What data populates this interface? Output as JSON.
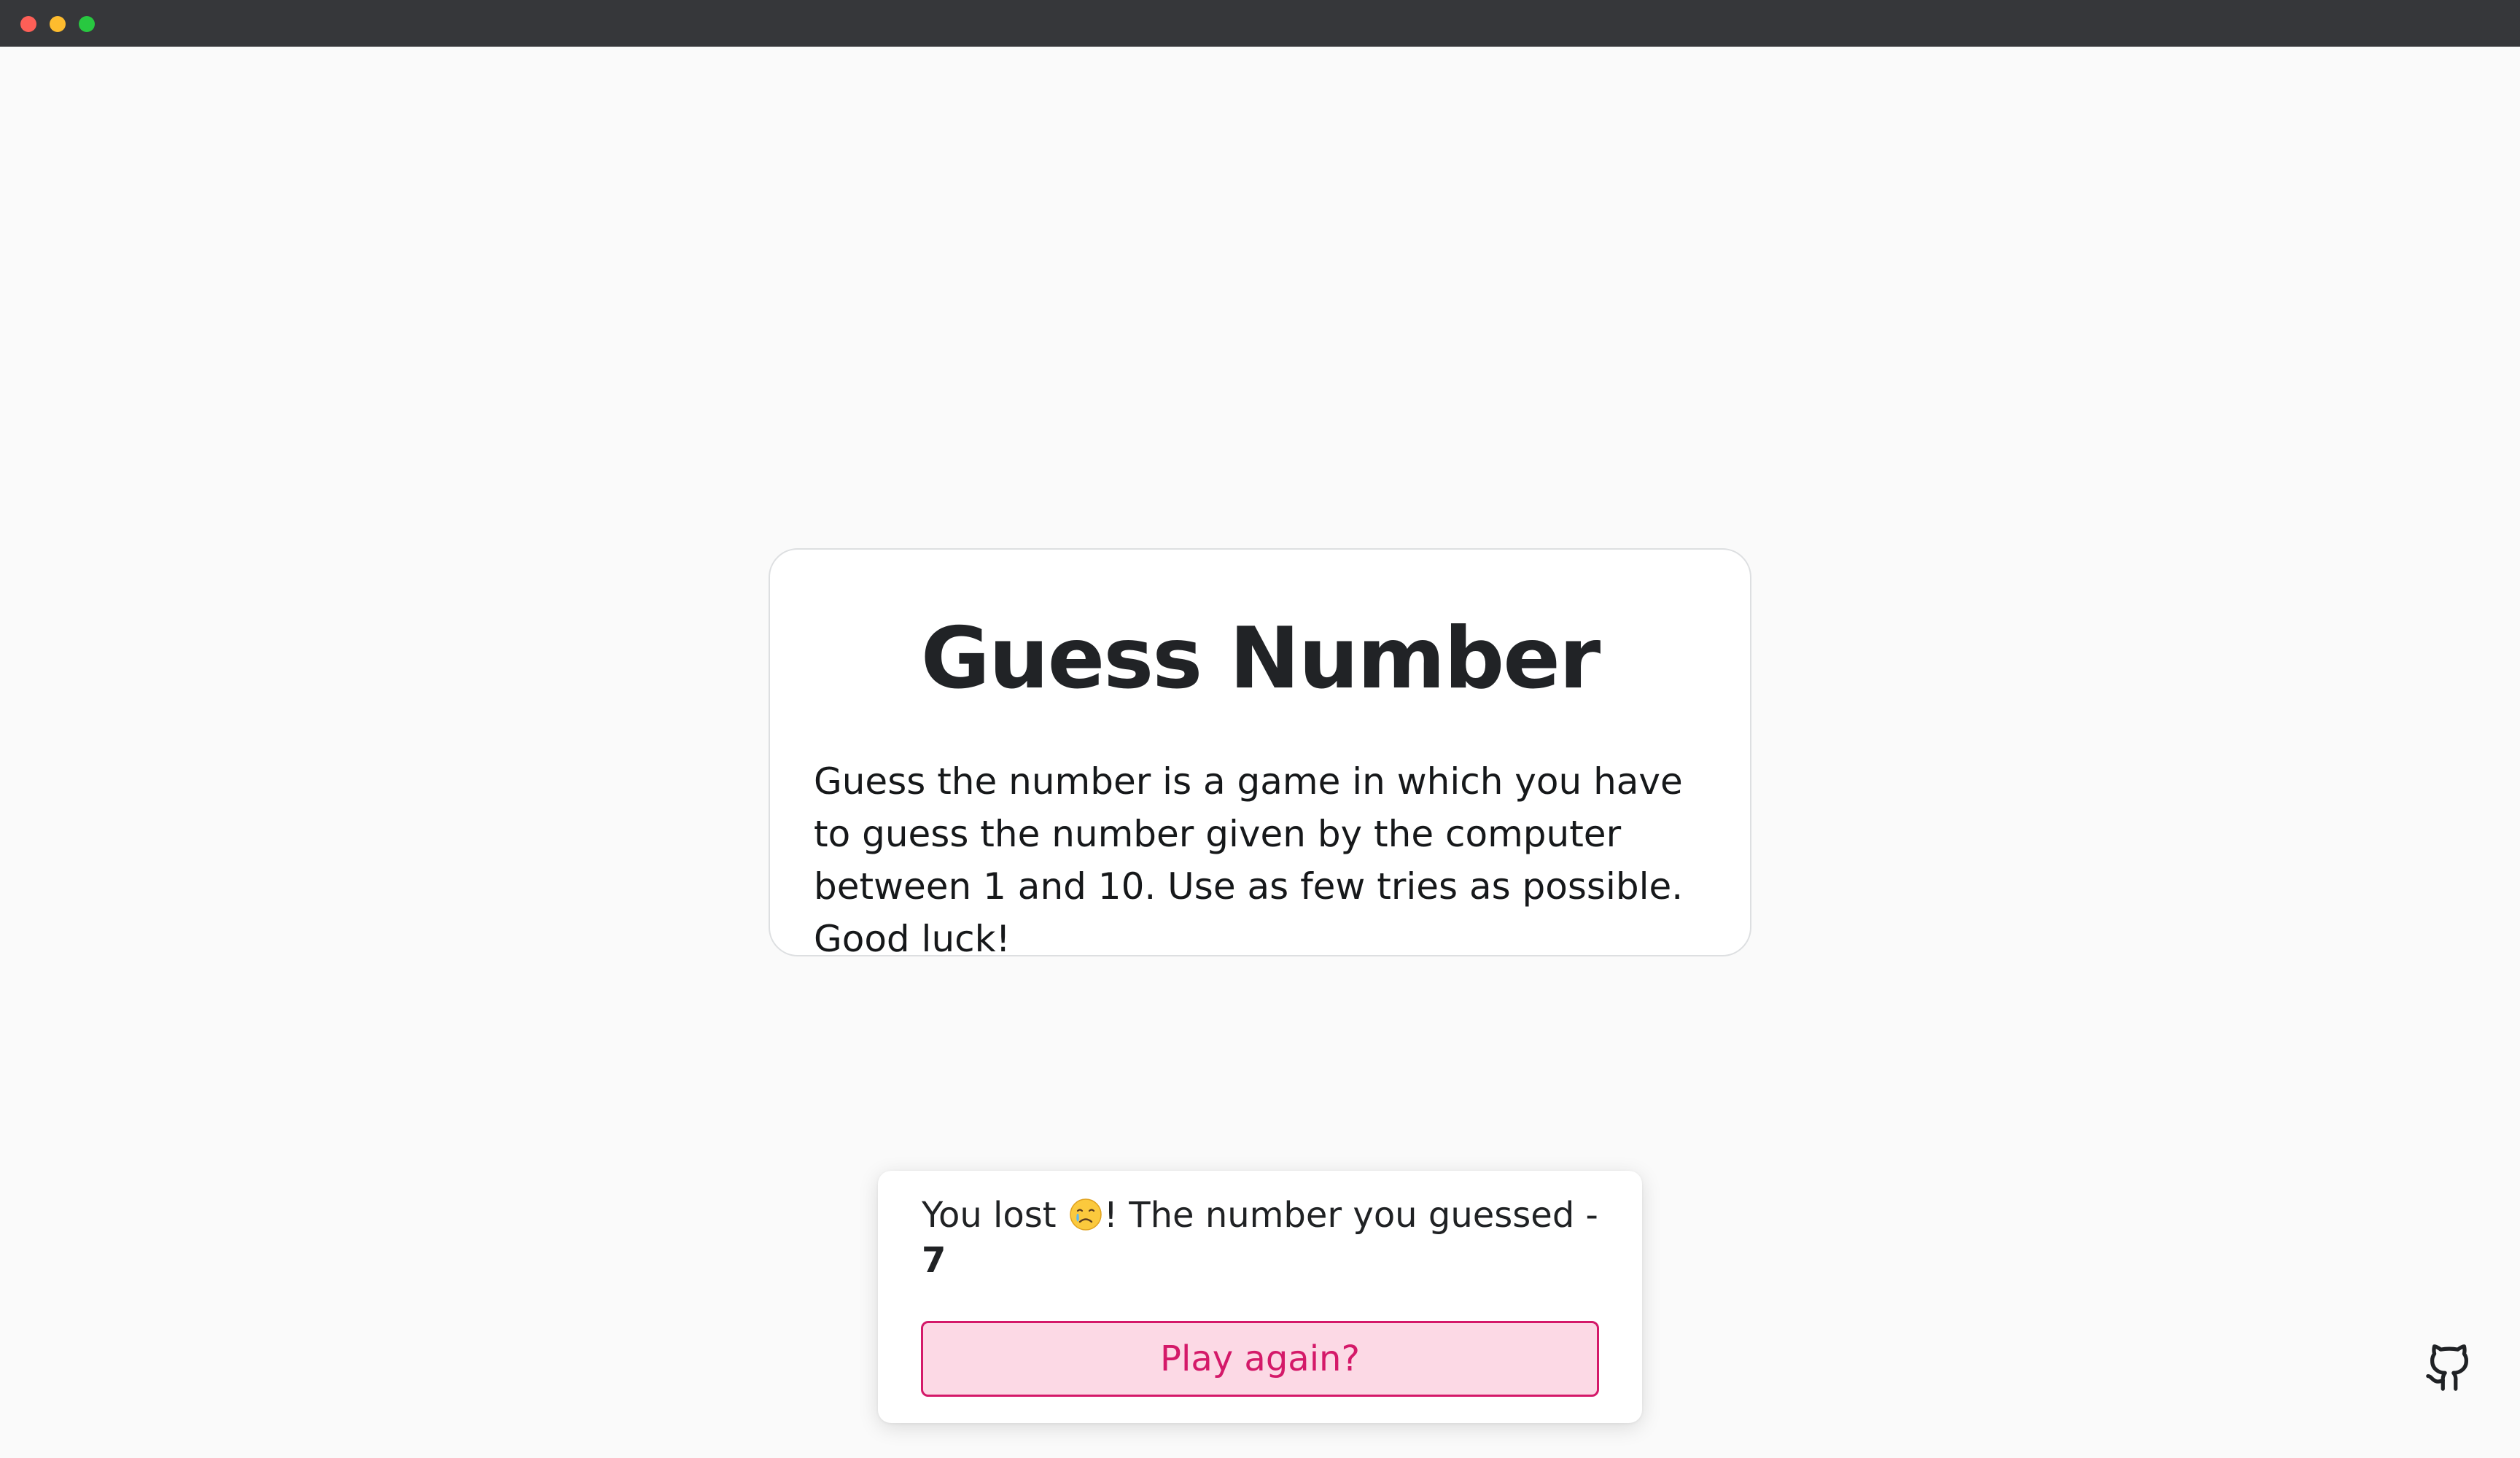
{
  "window": {
    "controls": [
      "close",
      "minimize",
      "maximize"
    ]
  },
  "card": {
    "title": "Guess Number",
    "description": "Guess the number is a game in which you have to guess the number given by the computer between 1 and 10. Use as few tries as possible. Good luck!"
  },
  "result": {
    "message_prefix": "You lost ",
    "emoji_icon": "crying-face-icon",
    "message_suffix": "! The number you guessed - ",
    "guessed_number": "7",
    "play_again_label": "Play again?"
  },
  "footer": {
    "repo_icon": "github-icon"
  },
  "colors": {
    "background": "#fafafa",
    "accent": "#d41969",
    "button_bg": "#fcd9e5",
    "titlebar": "#36373a"
  }
}
